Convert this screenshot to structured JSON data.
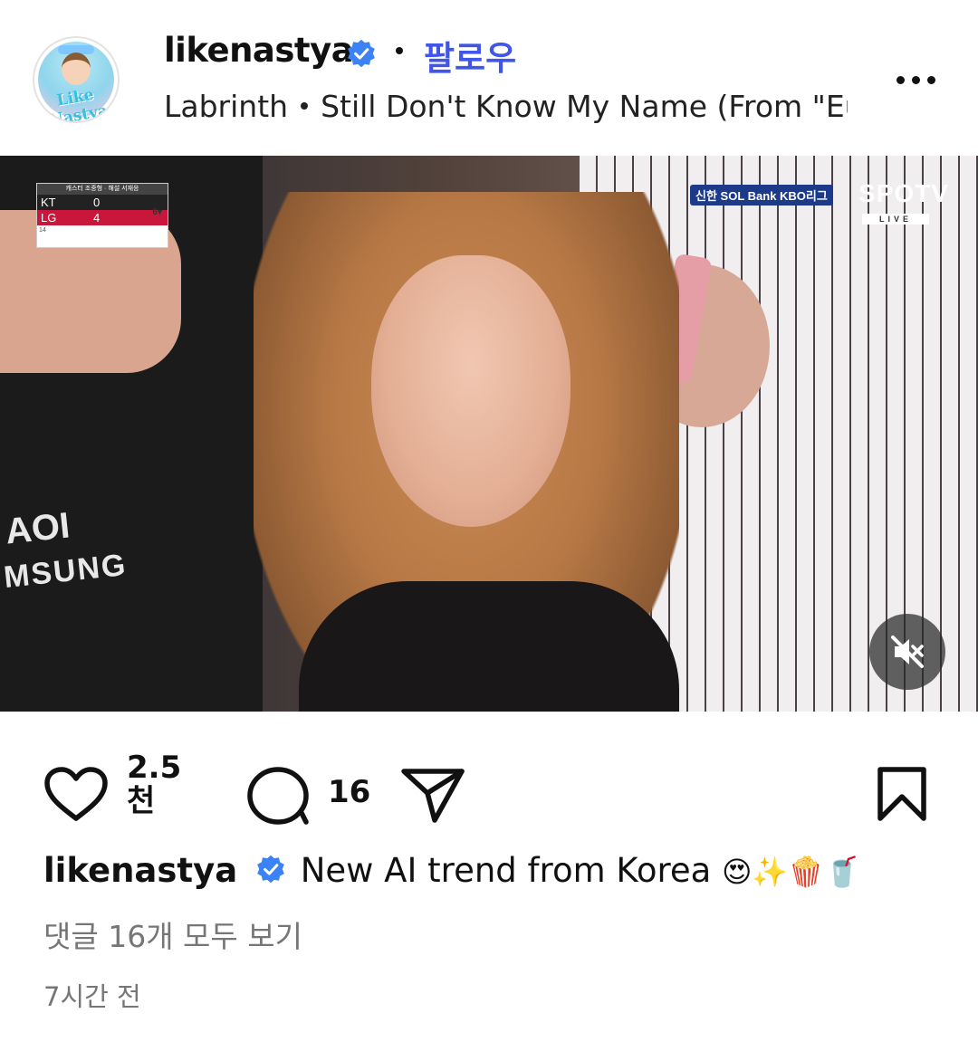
{
  "header": {
    "username": "likenastya",
    "follow_label": "팔로우",
    "music_artist": "Labrinth",
    "music_title": "Still Don't Know My Name (From \"Euphoria\"",
    "avatar_text": "Like Nastya",
    "verified_icon": "verified-badge-icon",
    "more_icon": "more-options-icon"
  },
  "media": {
    "scoreboard": {
      "header": "캐스터 조중형 · 해설 서재응",
      "team1": "KT",
      "score1": "0",
      "team2": "LG",
      "score2": "4",
      "inning": "6▾",
      "pitch": "14"
    },
    "broadcast_label": "신한 SOL Bank KBO리그",
    "channel": "SPOTV",
    "live": "LIVE",
    "brand_text": "AOI",
    "brand_text2": "MSUNG",
    "mute_icon": "muted-speaker-icon"
  },
  "actions": {
    "like_count_value": "2.5",
    "like_count_unit": "천",
    "comment_count": "16",
    "like_icon": "heart-icon",
    "comment_icon": "comment-icon",
    "share_icon": "send-icon",
    "save_icon": "bookmark-icon"
  },
  "caption": {
    "username": "likenastya",
    "text": "New AI trend from Korea",
    "emojis": "😍✨🍿🥤"
  },
  "view_comments": "댓글 16개 모두 보기",
  "timestamp": "7시간 전",
  "colors": {
    "accent": "#4056e8",
    "verified": "#3b82f6",
    "muted_text": "#767676"
  }
}
